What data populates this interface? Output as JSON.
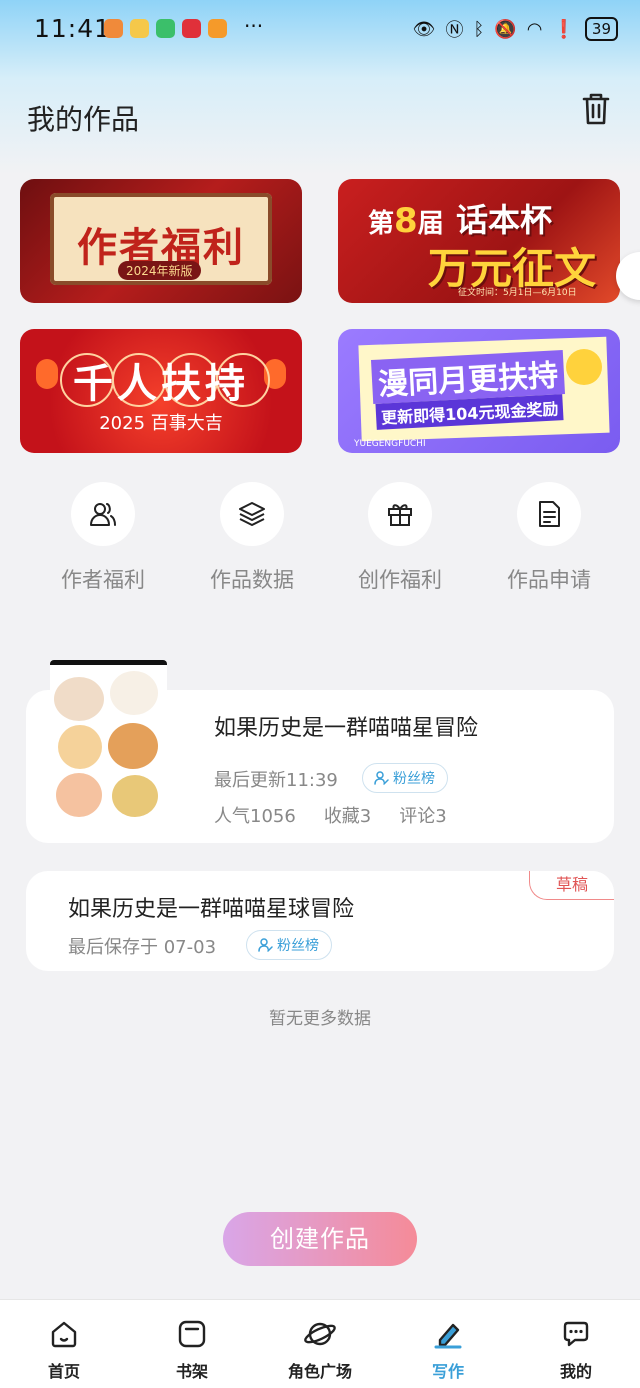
{
  "status_bar": {
    "time": "11:41",
    "dots": "···",
    "battery": "39"
  },
  "header": {
    "title": "我的作品",
    "trash_icon": "trash-icon"
  },
  "banners": [
    {
      "title": "作者福利",
      "subtitle": "2024年新版"
    },
    {
      "prefix_a": "第",
      "num": "8",
      "prefix_b": "届",
      "title": "话本杯",
      "headline": "万元征文",
      "note": "征文时间：5月1日—6月10日"
    },
    {
      "title": "千人扶持",
      "subtitle": "2025 百事大吉"
    },
    {
      "title": "漫同月更扶持",
      "subtitle": "更新即得104元现金奖励",
      "tag": "YUEGENGFUCHI"
    }
  ],
  "quick_actions": [
    {
      "label": "作者福利",
      "icon": "users-icon"
    },
    {
      "label": "作品数据",
      "icon": "layers-icon"
    },
    {
      "label": "创作福利",
      "icon": "gift-icon"
    },
    {
      "label": "作品申请",
      "icon": "document-icon"
    }
  ],
  "works": [
    {
      "title": "如果历史是一群喵喵星冒险",
      "updated": "最后更新11:39",
      "fans_label": "粉丝榜",
      "popularity": "人气1056",
      "favorites": "收藏3",
      "comments": "评论3"
    },
    {
      "title": "如果历史是一群喵喵星球冒险",
      "saved": "最后保存于 07-03",
      "fans_label": "粉丝榜",
      "badge": "草稿"
    }
  ],
  "no_more": "暂无更多数据",
  "create_button": "创建作品",
  "nav": [
    {
      "label": "首页",
      "icon": "home-icon"
    },
    {
      "label": "书架",
      "icon": "bookshelf-icon"
    },
    {
      "label": "角色广场",
      "icon": "planet-icon"
    },
    {
      "label": "写作",
      "icon": "pen-icon"
    },
    {
      "label": "我的",
      "icon": "chat-icon"
    }
  ],
  "colors": {
    "accent": "#3a9fd8",
    "draft_badge": "#e05555",
    "create_gradient_start": "#d9a6e8",
    "create_gradient_end": "#f58b98"
  }
}
